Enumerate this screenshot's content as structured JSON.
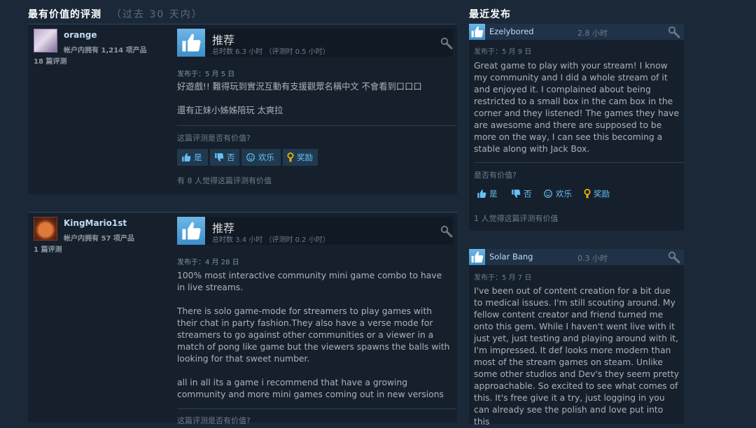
{
  "left": {
    "title": "最有价值的评测",
    "subtitle": "（过去 30 天内）",
    "reviews": [
      {
        "author": "orange",
        "owned": "帐户内拥有 1,214 项产品",
        "review_count": "18 篇评测",
        "verdict": "推荐",
        "hours": "总时数 6.3 小时 （评测时 0.5 小时）",
        "posted": "发布于：5 月 5 日",
        "paragraphs": [
          "好遊戲!! 難得玩到實況互動有支援觀眾名稱中文 不會看到口口口",
          "還有正妹小姊姊陪玩 太爽拉"
        ],
        "helpful_q": "这篇评测是否有价值?",
        "found_helpful": "有 8 人觉得这篇评测有价值"
      },
      {
        "author": "KingMario1st",
        "owned": "帐户内拥有 57 项产品",
        "review_count": "1 篇评测",
        "verdict": "推荐",
        "hours": "总时数 3.4 小时 （评测时 0.2 小时）",
        "posted": "发布于：4 月 28 日",
        "paragraphs": [
          "100% most interactive community mini game combo to have in live streams.",
          "There is solo game-mode for streamers to play games with their chat in party fashion.They also have a verse mode for streamers to go against other communities or a viewer in a match of pong like game but the viewers spawns the balls with looking for that sweet number.",
          "all in all its a game i recommend that have a growing community and more mini games coming out in new versions"
        ],
        "helpful_q": "这篇评测是否有价值?"
      }
    ],
    "buttons": {
      "yes": "是",
      "no": "否",
      "funny": "欢乐",
      "award": "奖励"
    }
  },
  "right": {
    "title": "最近发布",
    "reviews": [
      {
        "author": "Ezelybored",
        "hours": "2.8 小时",
        "posted": "发布于：5 月 9 日",
        "text": "Great game to play with your stream! I know my community and I did a whole stream of it and enjoyed it. I complained about being restricted to a small box in the cam box in the corner and they listened! The games they have are awesome and there are supposed to be more on the way, I can see this becoming a stable along with Jack Box.",
        "helpful_q": "是否有价值?",
        "found_helpful": "1 人觉得这篇评测有价值"
      },
      {
        "author": "Solar Bang",
        "hours": "0.3 小时",
        "posted": "发布于：5 月 7 日",
        "text": "I've been out of content creation for a bit due to medical issues. I'm still scouting around. My fellow content creator and friend turned me onto this gem. While I haven't went live with it just yet, just testing and playing around with it, I'm impressed. It def looks more modern than most of the stream games on steam. Unlike some other studios and Dev's they seem pretty approachable. So excited to see what comes of this. It's free give it a try, just logging in you can already see the polish and love put into this"
      }
    ],
    "buttons": {
      "yes": "是",
      "no": "否",
      "funny": "欢乐",
      "award": "奖励"
    }
  },
  "colors": {
    "background": "#1b2838",
    "panel": "#16202d",
    "link": "#66c0f4",
    "author": "#c1dbf4"
  },
  "icons": [
    "thumbs-up-icon",
    "thumbs-down-icon",
    "smiley-icon",
    "award-icon",
    "info-icon"
  ]
}
